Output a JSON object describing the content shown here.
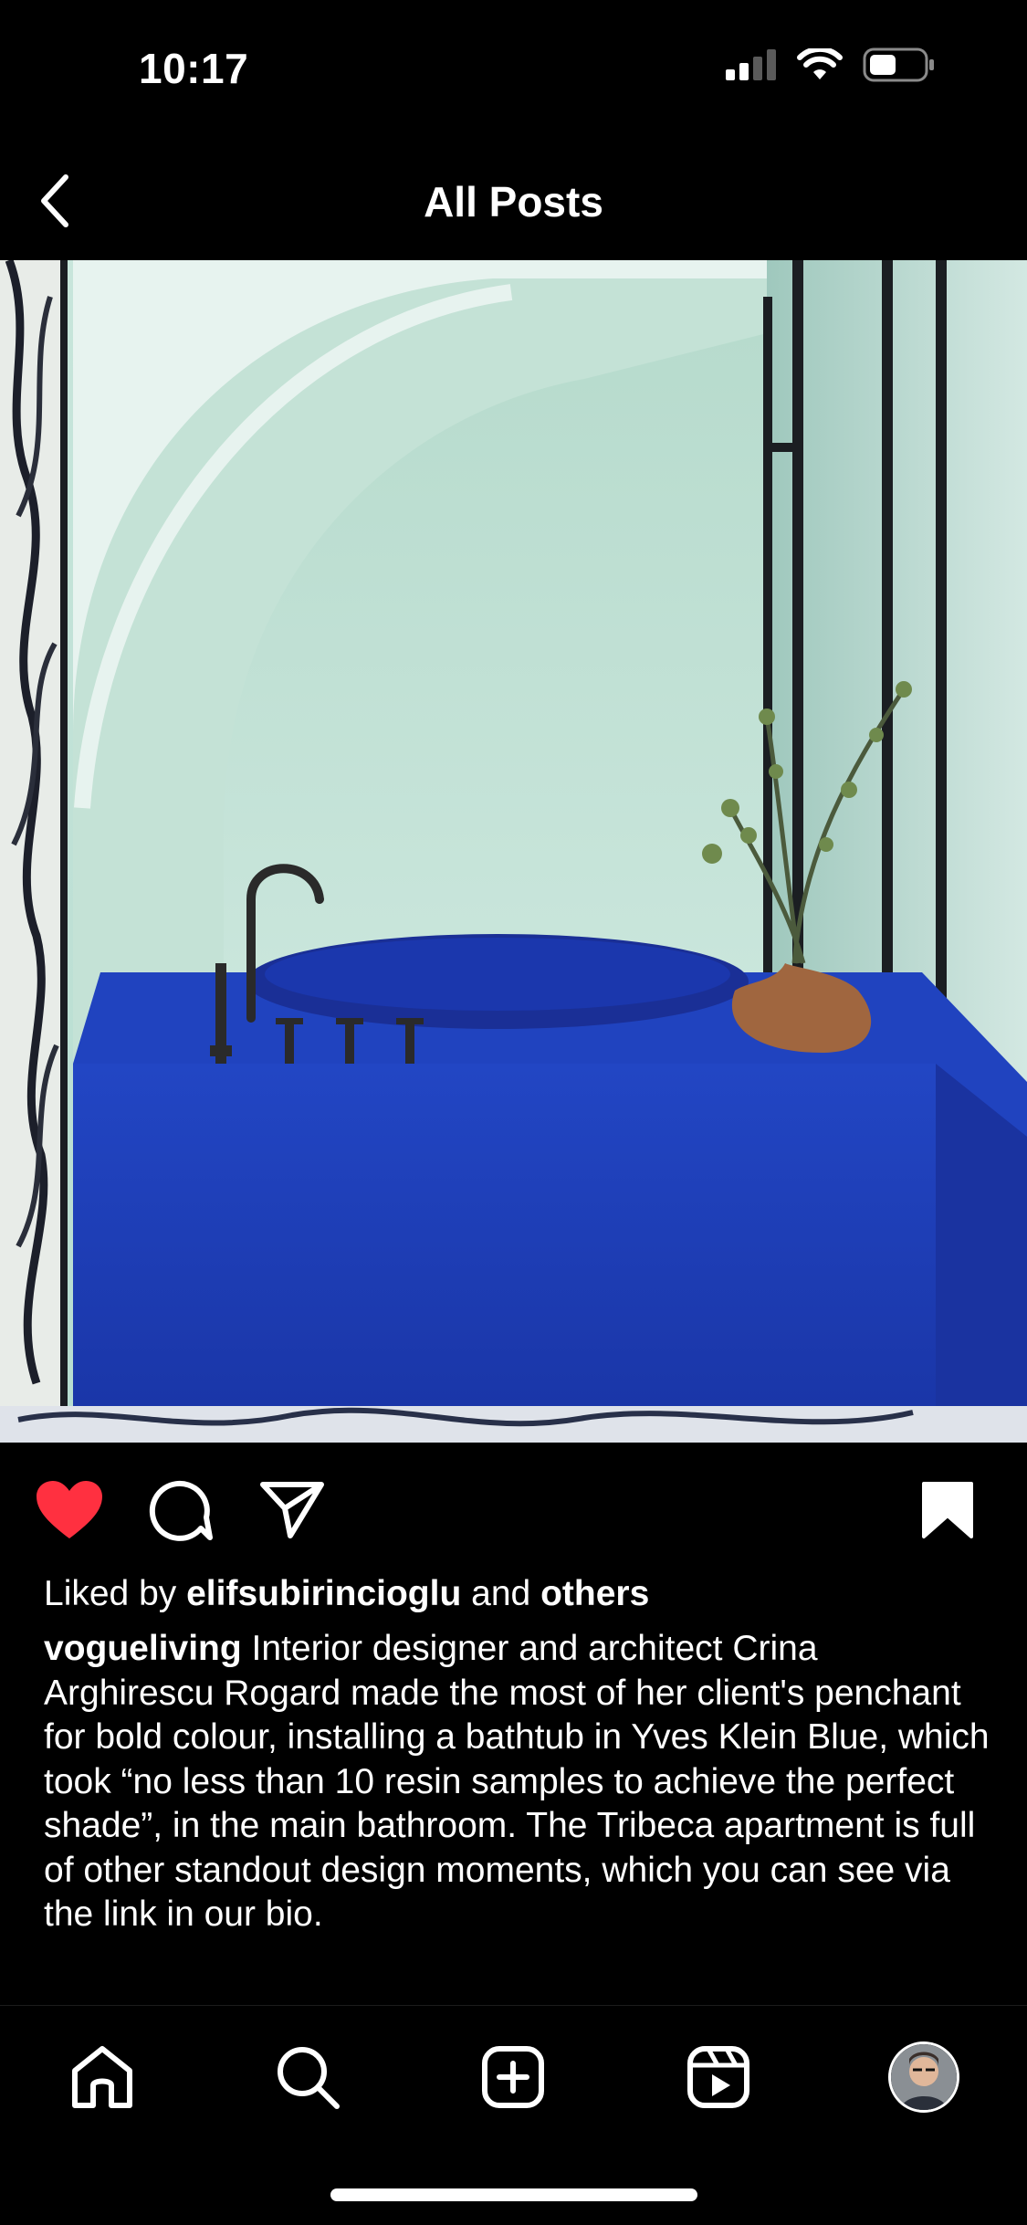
{
  "status_bar": {
    "time": "10:17",
    "icons": [
      "cellular-signal-icon",
      "wifi-icon",
      "battery-icon"
    ]
  },
  "header": {
    "back_icon": "chevron-left-icon",
    "title": "All Posts"
  },
  "post": {
    "image_alt": "Blue bathtub under a pale arched alcove with a vase of branches",
    "liked": true,
    "saved": true,
    "likes": {
      "prefix": "Liked by",
      "user": "elifsubirincioglu",
      "joiner": "and",
      "others": "others"
    },
    "caption": {
      "username": "vogueliving",
      "text": "Interior designer and architect Crina Arghirescu Rogard made the most of her client's penchant for bold colour, installing a bathtub in Yves Klein Blue, which took “no less than 10 resin samples to achieve the perfect shade”, in the main bathroom. The Tribeca apartment is full of other standout design moments, which you can see via the link in our bio."
    },
    "actions": [
      "heart-icon",
      "comment-icon",
      "share-icon",
      "bookmark-icon"
    ]
  },
  "tab_bar": {
    "items": [
      "home-icon",
      "search-icon",
      "create-icon",
      "reels-icon",
      "profile-avatar"
    ]
  },
  "colors": {
    "background": "#000000",
    "text": "#ffffff",
    "like_red": "#ff3040",
    "tub_blue": "#1f3fb8"
  }
}
